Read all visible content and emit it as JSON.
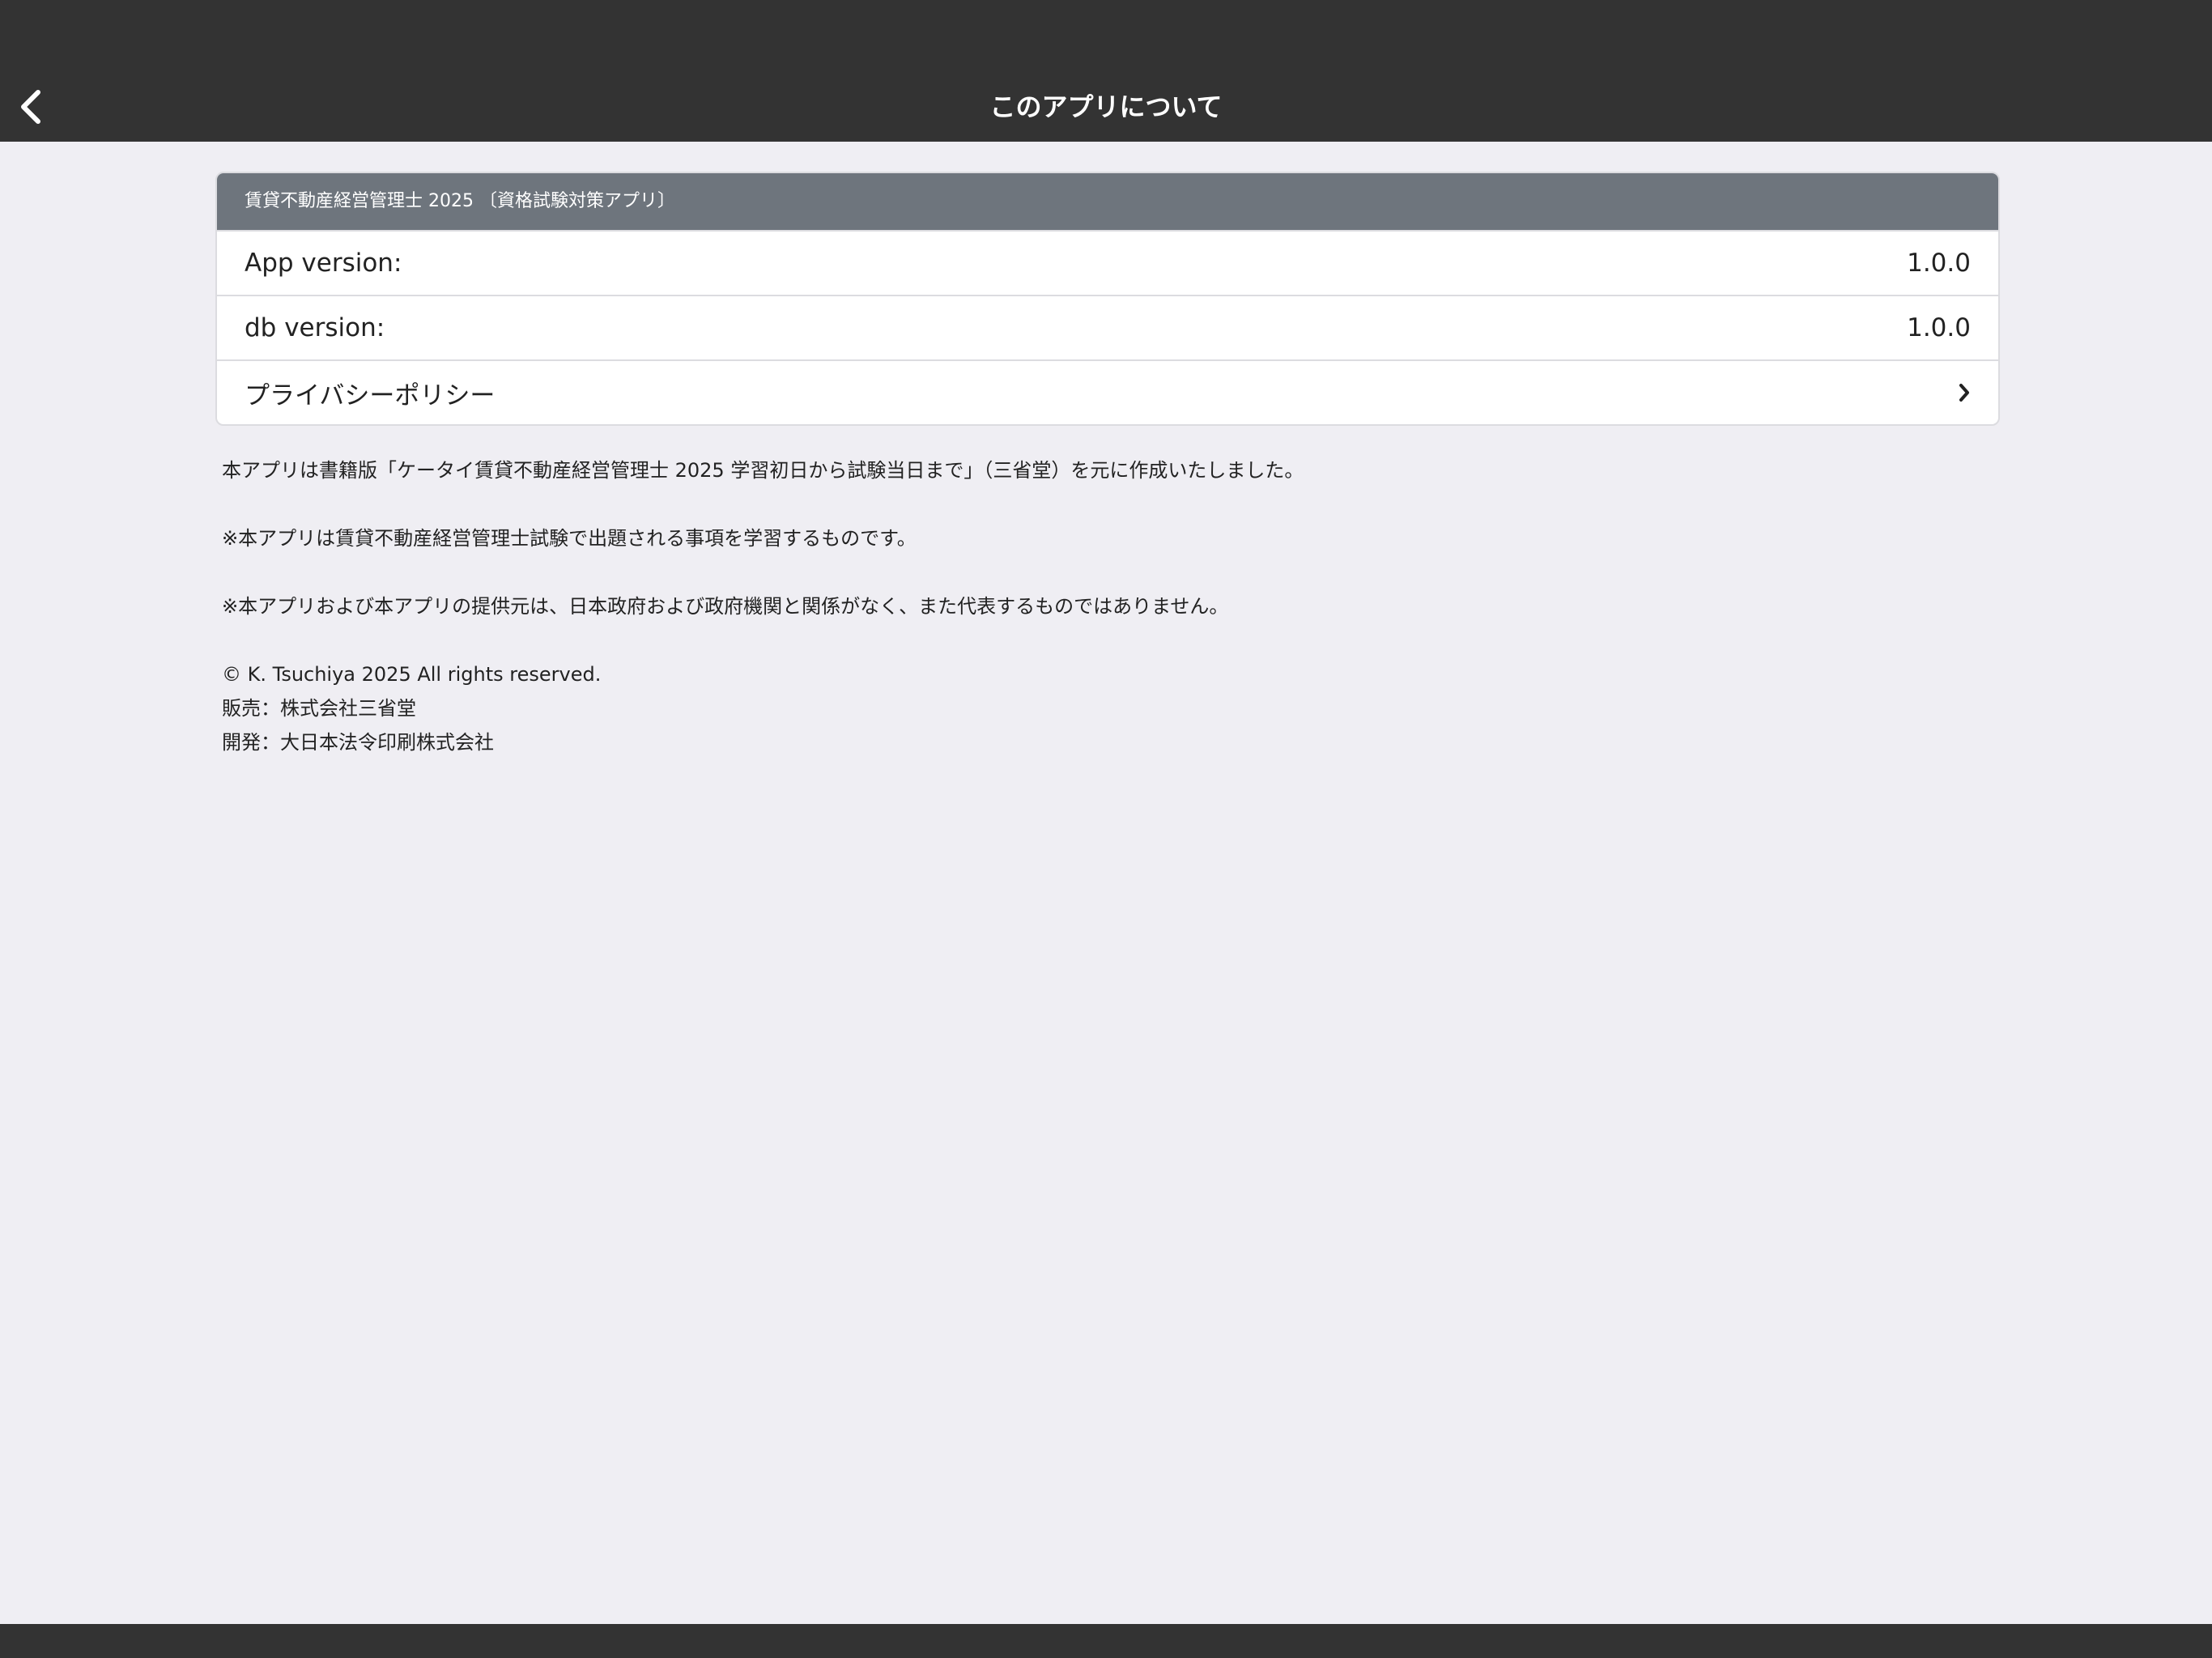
{
  "navbar": {
    "title": "このアプリについて",
    "back_icon": "chevron-left-icon"
  },
  "card": {
    "header": "賃貸不動産経営管理士 2025 〔資格試験対策アプリ〕",
    "rows": [
      {
        "label": "App version:",
        "value": "1.0.0"
      },
      {
        "label": "db version:",
        "value": "1.0.0"
      },
      {
        "label": "プライバシーポリシー",
        "icon": "chevron-right-icon"
      }
    ]
  },
  "info": {
    "line1": "本アプリは書籍版「ケータイ賃貸不動産経営管理士 2025 学習初日から試験当日まで」（三省堂）を元に作成いたしました。",
    "line2": "※本アプリは賃貸不動産経営管理士試験で出題される事項を学習するものです。",
    "line3": "※本アプリおよび本アプリの提供元は、日本政府および政府機関と関係がなく、また代表するものではありません。",
    "copyright": "© K. Tsuchiya 2025 All rights reserved.",
    "seller": "販売：株式会社三省堂",
    "developer": "開発：大日本法令印刷株式会社"
  },
  "colors": {
    "navbar_bg": "#333333",
    "card_header_bg": "#6e757d",
    "page_bg": "#efeef3"
  }
}
